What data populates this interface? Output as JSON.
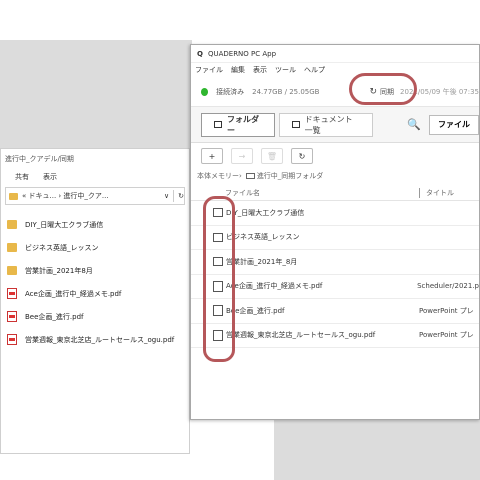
{
  "explorer": {
    "title": "進行中_クアデル/同期",
    "menu": [
      "共有",
      "表示"
    ],
    "address": "« ドキュ... › 進行中_クア...",
    "address_chevron": "∨",
    "refresh_icon": "↻",
    "items": [
      {
        "icon": "folder-icon",
        "label": "DIY_日曜大工クラブ通信"
      },
      {
        "icon": "folder-icon",
        "label": "ビジネス英語_レッスン"
      },
      {
        "icon": "folder-icon",
        "label": "営業計画_2021年8月"
      },
      {
        "icon": "pdf-icon",
        "label": "Ace企画_進行中_経過メモ.pdf"
      },
      {
        "icon": "pdf-icon",
        "label": "Bee企画_進行.pdf"
      },
      {
        "icon": "pdf-icon",
        "label": "営業週報_東京北芝店_ルートセールス_ogu.pdf"
      }
    ]
  },
  "app": {
    "logo": "Q",
    "title": "QUADERNO PC App",
    "menu": [
      "ファイル",
      "編集",
      "表示",
      "ツール",
      "ヘルプ"
    ],
    "status": {
      "connection": "接続済み",
      "storage": "24.77GB / 25.05GB",
      "sync_icon": "↻",
      "sync_label": "同期",
      "last_sync": "2021/05/09 午後 07:35"
    },
    "tabs": {
      "folder": "フォルダー",
      "documents": "ドキュメント一覧"
    },
    "search_icon": "🔍",
    "file_button": "ファイル",
    "toolbar": {
      "new_folder": "+",
      "move": "→",
      "delete": "🗑",
      "sync_folder": "↻"
    },
    "breadcrumb": {
      "root": "本体メモリー",
      "separator": "›",
      "current": "進行中_同期フォルダ"
    },
    "columns": {
      "name": "ファイル名",
      "title": "タイトル"
    },
    "rows": [
      {
        "type": "folder",
        "name": "DIY_日曜大工クラブ通信",
        "title": ""
      },
      {
        "type": "folder",
        "name": "ビジネス英語_レッスン",
        "title": ""
      },
      {
        "type": "folder",
        "name": "営業計画_2021年_8月",
        "title": ""
      },
      {
        "type": "doc",
        "name": "Ace企画_進行中_経過メモ.pdf",
        "title": "Scheduler/2021.p"
      },
      {
        "type": "doc",
        "name": "Bee企画_進行.pdf",
        "title": "PowerPoint プレ"
      },
      {
        "type": "doc",
        "name": "営業週報_東京北芝店_ルートセールス_ogu.pdf",
        "title": "PowerPoint プレ"
      }
    ]
  },
  "annotation_color": "#b5575a"
}
